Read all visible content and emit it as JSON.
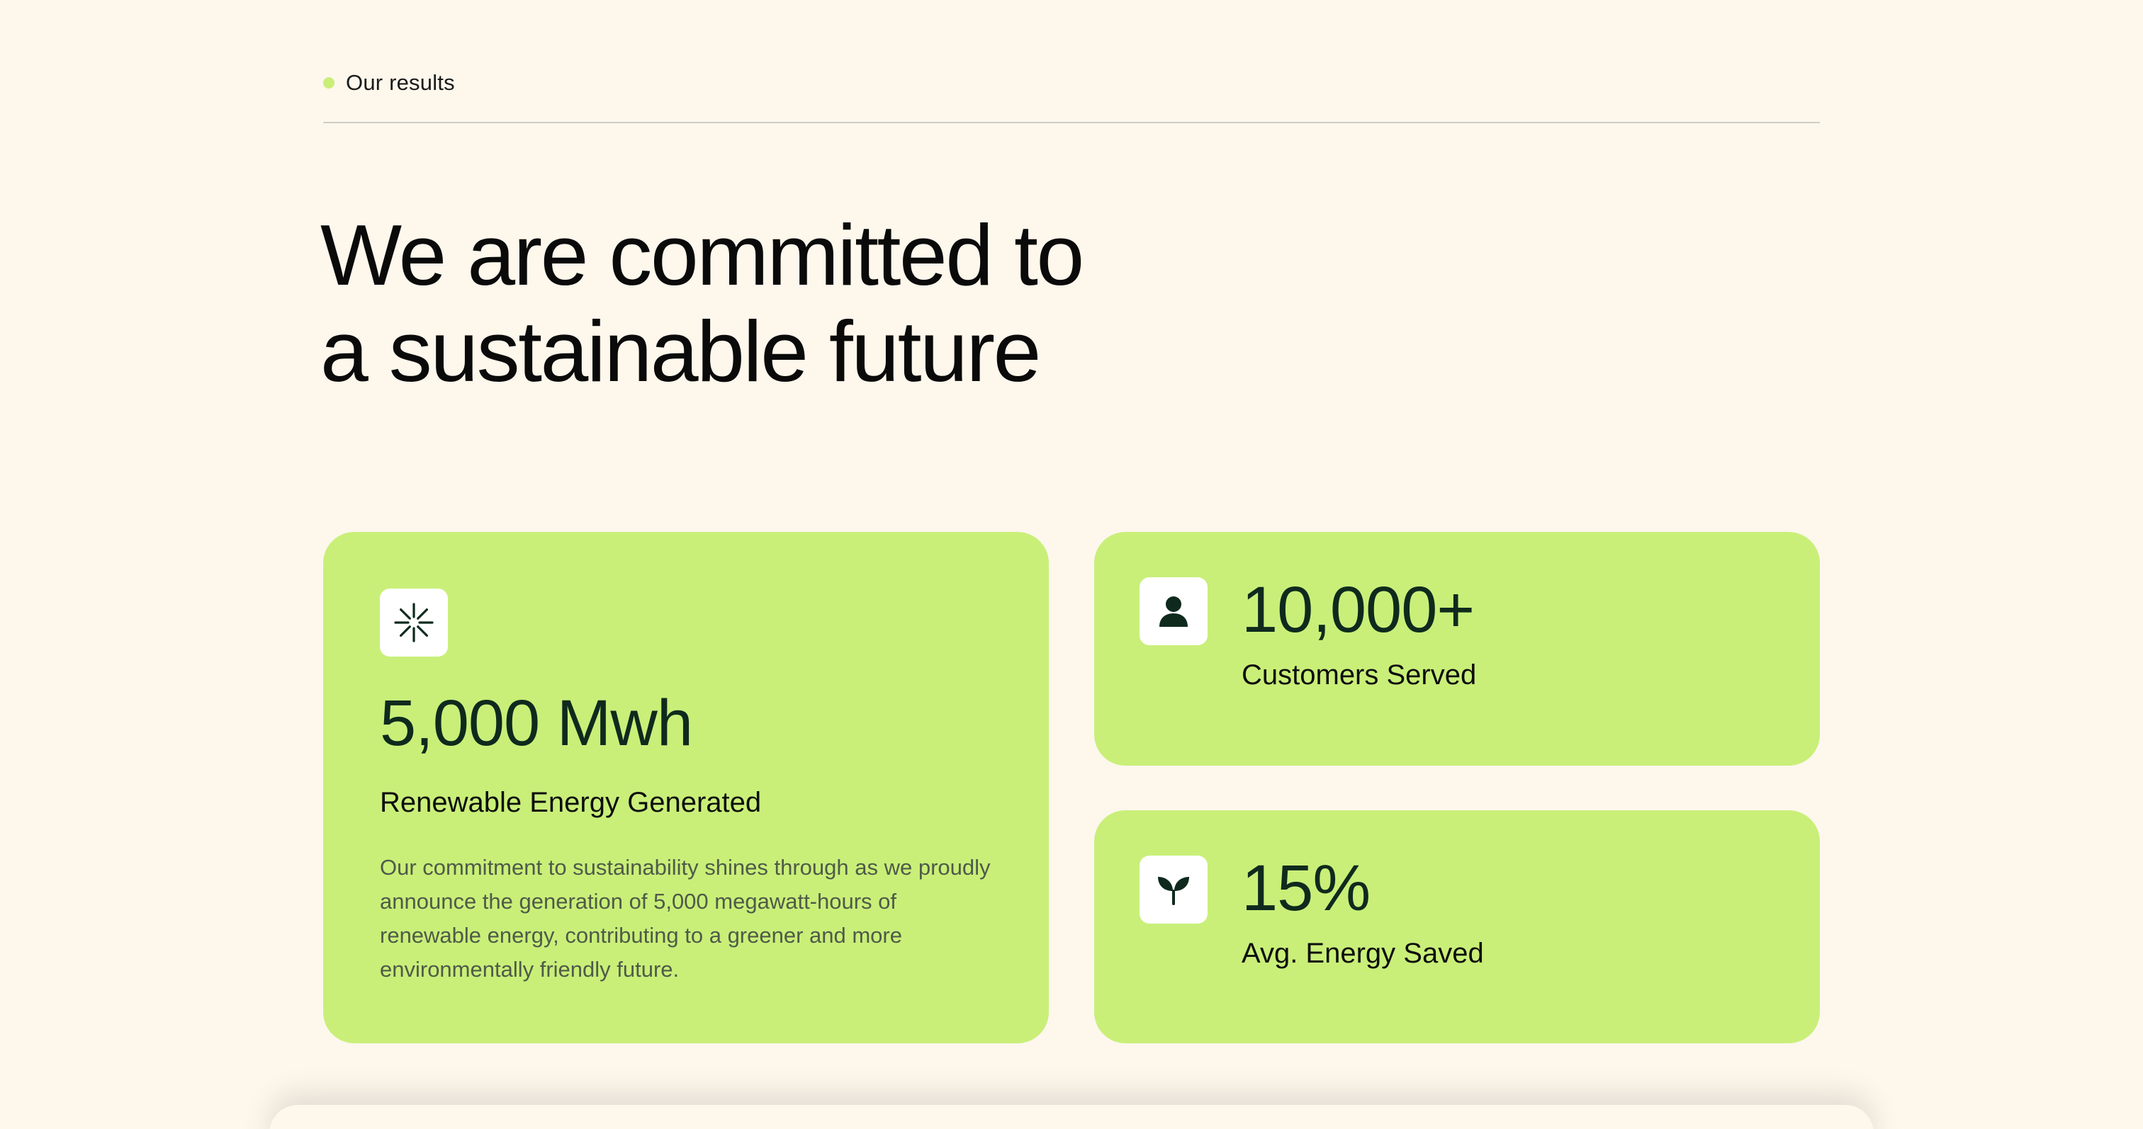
{
  "section": {
    "eyebrow": "Our results",
    "headline_line1": "We are committed to",
    "headline_line2": "a sustainable future"
  },
  "stats": {
    "main": {
      "icon": "sparkle-icon",
      "value": "5,000 Mwh",
      "label": "Renewable Energy Generated",
      "description": "Our commitment to sustainability shines through as we proudly announce the generation of 5,000 megawatt-hours of renewable energy, contributing to a greener and more environmentally friendly future."
    },
    "customers": {
      "icon": "user-icon",
      "value": "10,000+",
      "label": "Customers Served"
    },
    "energy_saved": {
      "icon": "sprout-icon",
      "value": "15%",
      "label": "Avg. Energy Saved"
    }
  },
  "colors": {
    "background": "#fdf7ec",
    "card": "#c9ef79",
    "accent_dot": "#c9ef79",
    "icon_fill": "#0f2a1d"
  }
}
